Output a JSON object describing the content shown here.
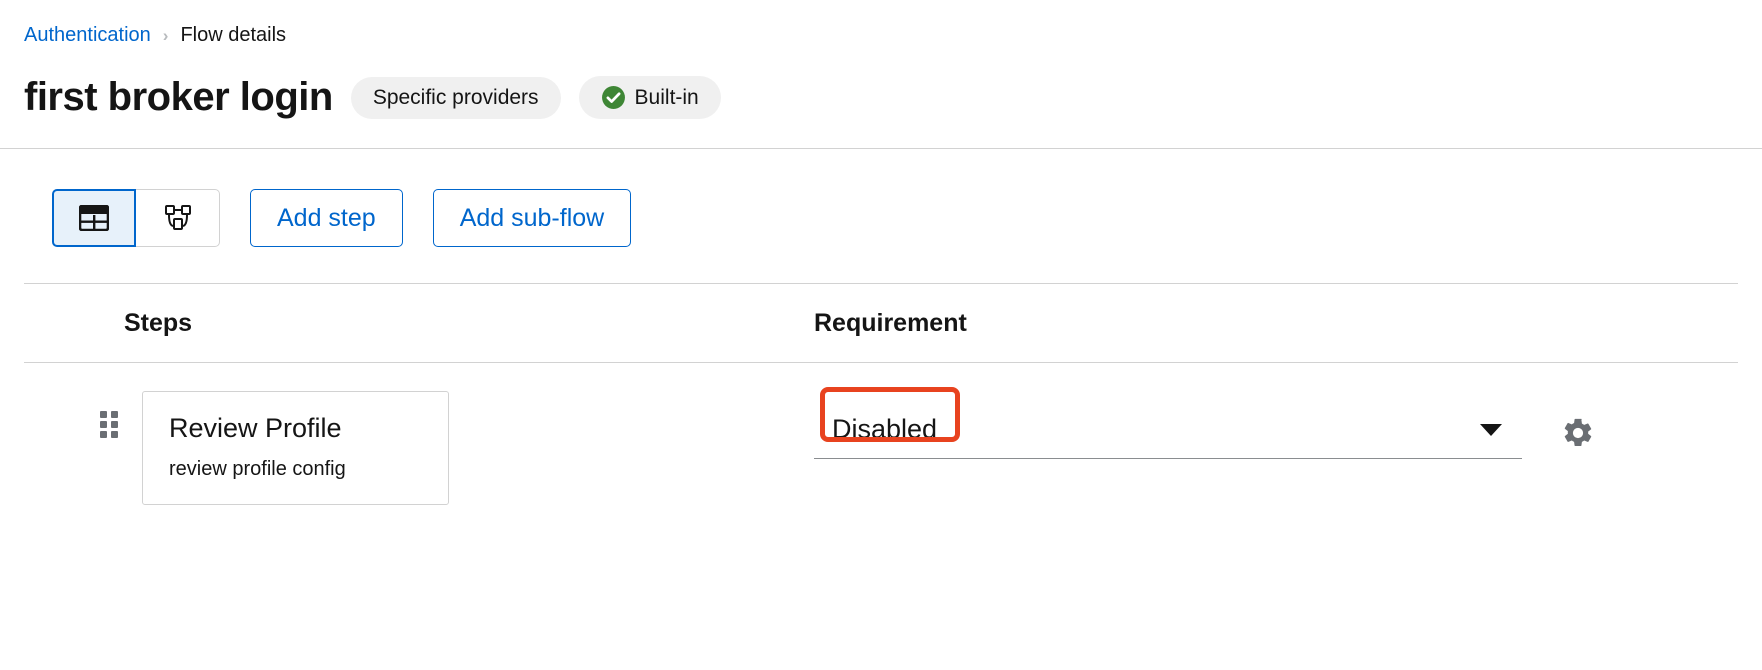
{
  "breadcrumb": {
    "parent": "Authentication",
    "separator": "›",
    "current": "Flow details"
  },
  "header": {
    "title": "first broker login",
    "chips": [
      {
        "label": "Specific providers",
        "icon": null
      },
      {
        "label": "Built-in",
        "icon": "check-circle-icon"
      }
    ]
  },
  "toolbar": {
    "view_toggle": [
      {
        "name": "table-view",
        "icon": "table-icon",
        "selected": true
      },
      {
        "name": "diagram-view",
        "icon": "topology-icon",
        "selected": false
      }
    ],
    "add_step_label": "Add step",
    "add_subflow_label": "Add sub-flow"
  },
  "table": {
    "columns": [
      "Steps",
      "Requirement"
    ],
    "rows": [
      {
        "drag_handle": "grip-icon",
        "step_title": "Review Profile",
        "step_subtitle": "review profile config",
        "requirement_value": "Disabled",
        "requirement_caret": "caret-down-icon",
        "settings_icon": "gear-icon",
        "highlighted": true
      }
    ]
  },
  "colors": {
    "link": "#0066cc",
    "text": "#151515",
    "border": "#d2d2d2",
    "chip_bg": "#f0f0f0",
    "success_green": "#3e8635",
    "annotation_red": "#e8431f",
    "toggle_selected_bg": "#e7f1fa",
    "muted": "#6a6e73"
  }
}
